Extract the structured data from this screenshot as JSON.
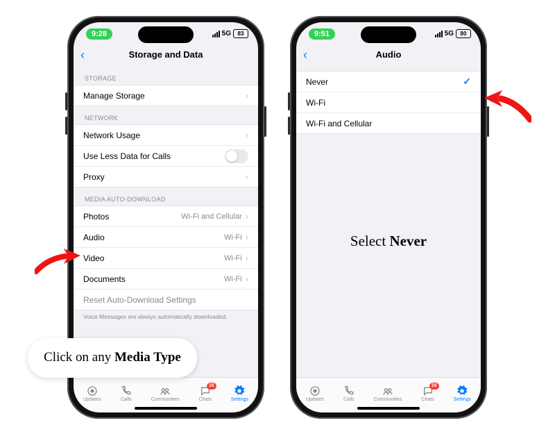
{
  "left": {
    "status": {
      "time": "9:28",
      "net": "5G",
      "battery": "83"
    },
    "title": "Storage and Data",
    "sections": {
      "storage_label": "STORAGE",
      "manage_storage": "Manage Storage",
      "network_label": "NETWORK",
      "network_usage": "Network Usage",
      "less_data": "Use Less Data for Calls",
      "proxy": "Proxy",
      "media_label": "MEDIA AUTO-DOWNLOAD",
      "media": [
        {
          "label": "Photos",
          "value": "Wi-Fi and Cellular"
        },
        {
          "label": "Audio",
          "value": "Wi-Fi"
        },
        {
          "label": "Video",
          "value": "Wi-Fi"
        },
        {
          "label": "Documents",
          "value": "Wi-Fi"
        }
      ],
      "reset": "Reset Auto-Download Settings",
      "footer": "Voice Messages are always automatically downloaded."
    }
  },
  "right": {
    "status": {
      "time": "9:51",
      "net": "5G",
      "battery": "80"
    },
    "title": "Audio",
    "options": [
      {
        "label": "Never",
        "selected": true
      },
      {
        "label": "Wi-Fi",
        "selected": false
      },
      {
        "label": "Wi-Fi and Cellular",
        "selected": false
      }
    ]
  },
  "tabs": {
    "updates": "Updates",
    "calls": "Calls",
    "communities": "Communities",
    "chats": "Chats",
    "chats_badge": "16",
    "settings": "Settings"
  },
  "annotations": {
    "left_balloon_a": "Click on any ",
    "left_balloon_b": "Media Type",
    "right_text_a": "Select ",
    "right_text_b": "Never"
  }
}
